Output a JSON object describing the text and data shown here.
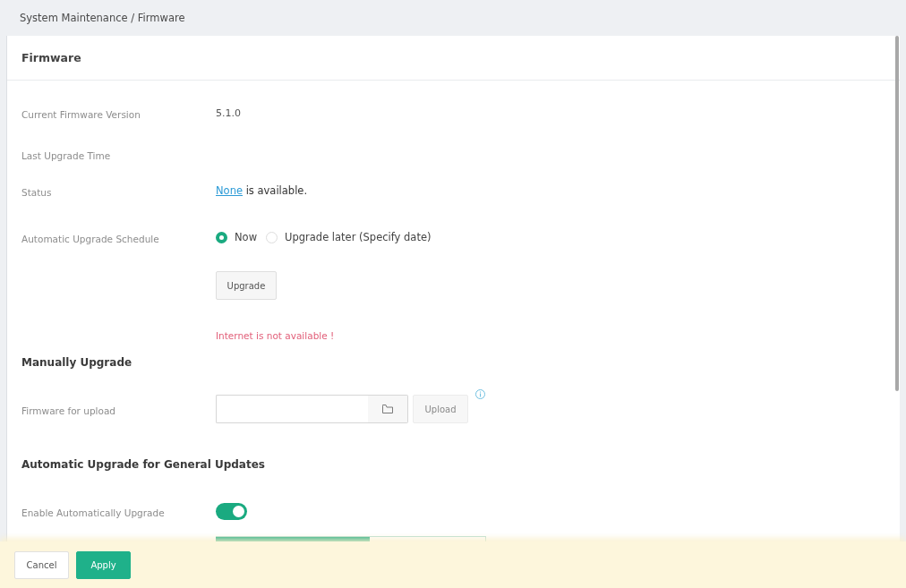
{
  "breadcrumb": "System Maintenance / Firmware",
  "card": {
    "title": "Firmware",
    "sections": [
      {
        "rows": [
          {
            "kind": "text",
            "label": "Current Firmware Version",
            "value": "5.1.0"
          },
          {
            "kind": "text",
            "label": "Last Upgrade Time"
          },
          {
            "kind": "status",
            "label": "Status",
            "link": "None",
            "text": "is available."
          },
          {
            "kind": "radio",
            "label": "Automatic Upgrade Schedule",
            "options": [
              {
                "label": "Now",
                "selected": true
              },
              {
                "label": "Upgrade later (Specify date)",
                "selected": false
              }
            ]
          },
          {
            "kind": "button",
            "button": "Upgrade"
          },
          {
            "kind": "error",
            "text": "Internet is not available !"
          }
        ]
      },
      {
        "heading": "Manually Upgrade",
        "rows": [
          {
            "kind": "file",
            "label": "Firmware for upload",
            "button": "Upload"
          }
        ]
      },
      {
        "heading": "Automatic Upgrade for General Updates",
        "rows": [
          {
            "kind": "toggle",
            "label": "Enable Automatically Upgrade",
            "on": true
          },
          {
            "kind": "progress",
            "level": 0.57
          }
        ]
      }
    ]
  },
  "footer": {
    "buttons": [
      {
        "label": "Cancel",
        "kind": "secondary"
      },
      {
        "label": "Apply",
        "kind": "primary"
      }
    ]
  }
}
